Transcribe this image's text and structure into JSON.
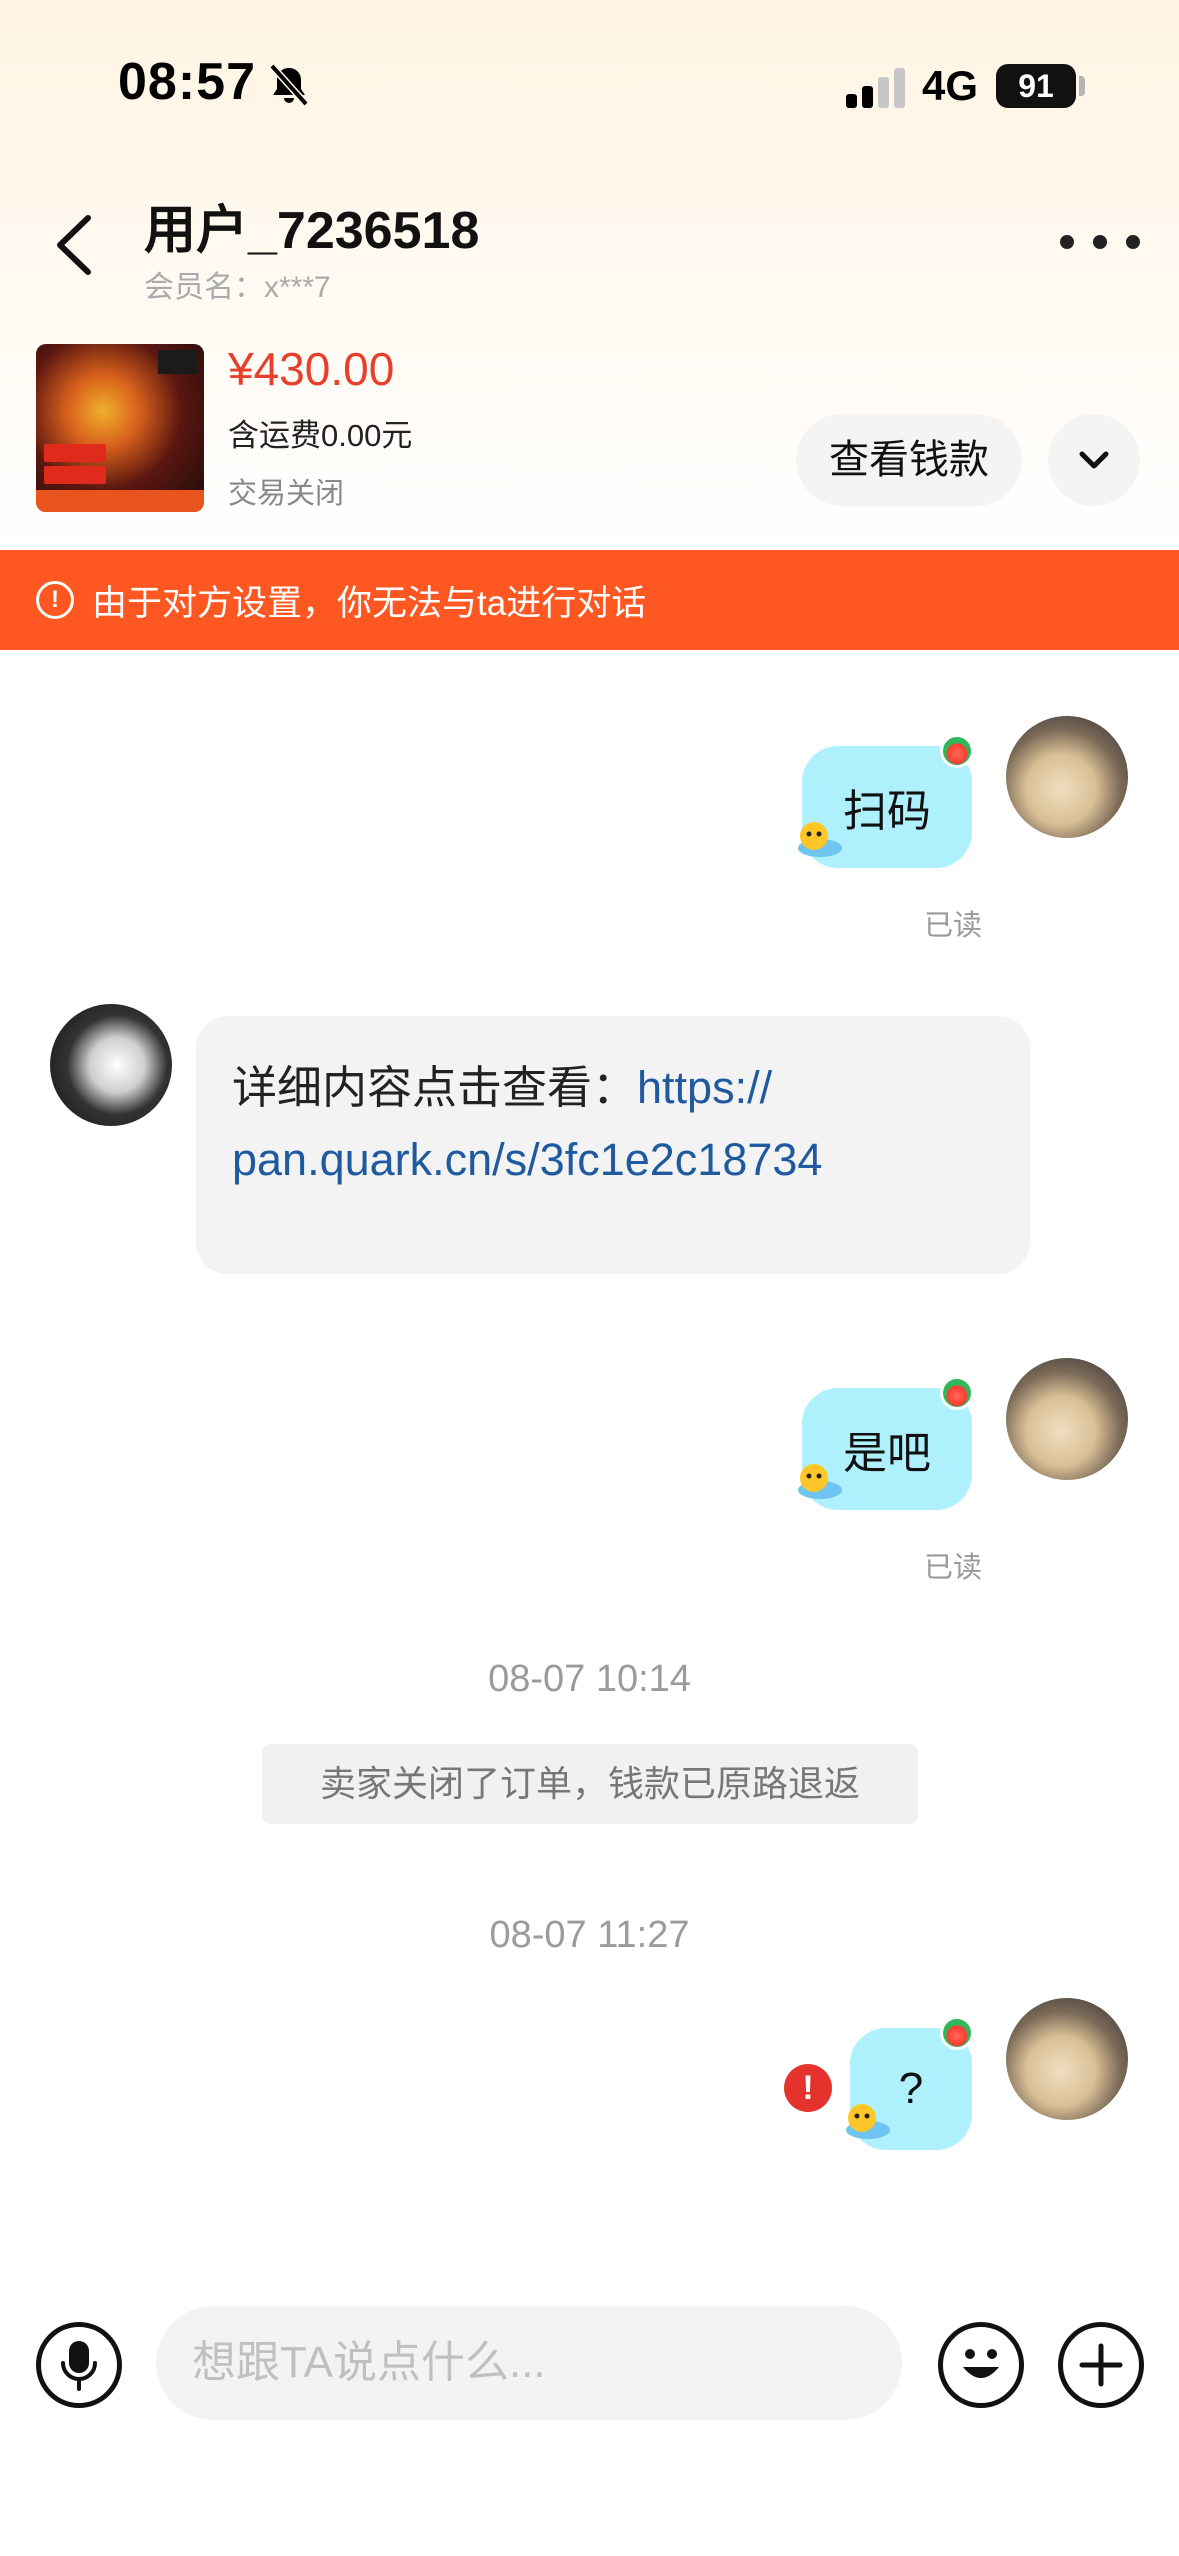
{
  "status_bar": {
    "time": "08:57",
    "network": "4G",
    "battery": "91"
  },
  "header": {
    "title": "用户_7236518",
    "member_name": "会员名：x***7"
  },
  "product": {
    "price": "¥430.00",
    "shipping": "含运费0.00元",
    "status": "交易关闭",
    "view_money_label": "查看钱款"
  },
  "banner": {
    "text": "由于对方设置，你无法与ta进行对话"
  },
  "messages": [
    {
      "sender": "self",
      "text": "扫码",
      "status": "已读"
    },
    {
      "sender": "other",
      "text_prefix": "详细内容点击查看：",
      "link": "https://\npan.quark.cn/s/3fc1e2c18734"
    },
    {
      "sender": "self",
      "text": "是吧",
      "status": "已读"
    },
    {
      "type": "timestamp",
      "text": "08-07 10:14"
    },
    {
      "type": "system",
      "text": "卖家关闭了订单，钱款已原路退返"
    },
    {
      "type": "timestamp",
      "text": "08-07 11:27"
    },
    {
      "sender": "self",
      "text": "?",
      "failed": true
    }
  ],
  "input_bar": {
    "placeholder": "想跟TA说点什么..."
  },
  "colors": {
    "accent_red": "#e6402c",
    "banner_orange": "#ff5722",
    "bubble_blue": "#aef0fb",
    "link_blue": "#1f5aa0"
  }
}
